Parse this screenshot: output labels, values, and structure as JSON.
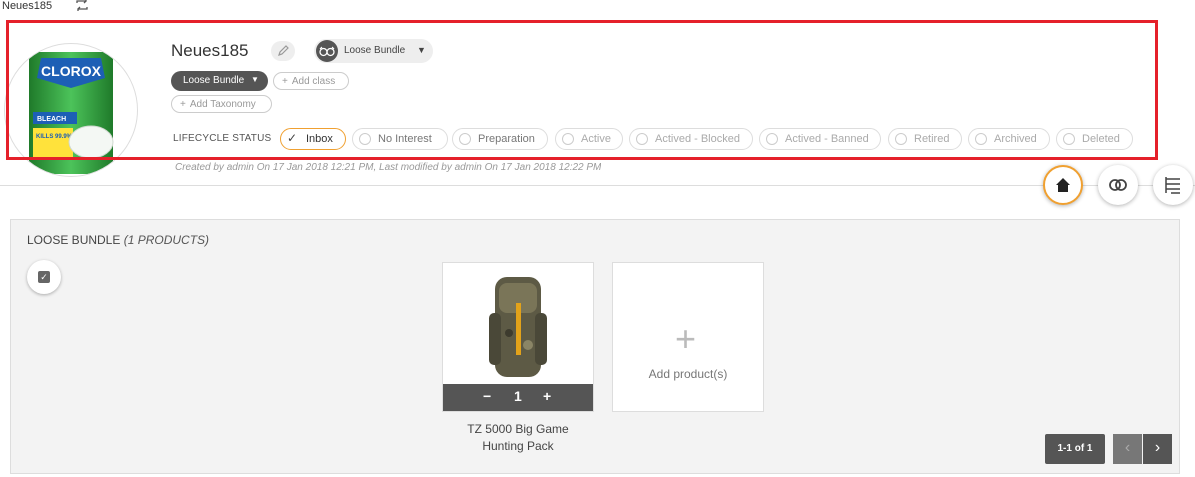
{
  "window": {
    "title": "Neues185",
    "refresh_icon": "refresh-icon"
  },
  "header": {
    "product_name": "Neues185",
    "bundle_type": "Loose Bundle",
    "class_label": "Loose Bundle",
    "add_class": "Add class",
    "add_taxonomy": "Add Taxonomy",
    "lifecycle_label": "LIFECYCLE STATUS",
    "lifecycle": [
      {
        "label": "Inbox",
        "selected": true
      },
      {
        "label": "No Interest",
        "selected": false
      },
      {
        "label": "Preparation",
        "selected": false
      },
      {
        "label": "Active",
        "selected": false
      },
      {
        "label": "Actived - Blocked",
        "selected": false
      },
      {
        "label": "Actived - Banned",
        "selected": false
      },
      {
        "label": "Retired",
        "selected": false
      },
      {
        "label": "Archived",
        "selected": false
      },
      {
        "label": "Deleted",
        "selected": false
      }
    ],
    "created_text": "Created by admin On 17 Jan 2018 12:21 PM, Last modified by admin On 17 Jan 2018 12:22 PM",
    "avatar_brand": "CLOROX",
    "avatar_sub": "BLEACH",
    "avatar_badge": "KILLS 99.9%"
  },
  "actions": {
    "home_icon": "home-icon",
    "link_icon": "link-icon",
    "tree_icon": "tree-icon"
  },
  "panel": {
    "title": "LOOSE BUNDLE",
    "count": "(1 PRODUCTS)",
    "products": [
      {
        "name_line1": "TZ 5000 Big Game",
        "name_line2": "Hunting Pack",
        "quantity": "1",
        "minus": "−",
        "plus": "+"
      }
    ],
    "add_label": "Add product(s)",
    "add_symbol": "+",
    "pager": "1-1 of 1",
    "prev": "‹",
    "next": "›"
  },
  "colors": {
    "highlight": "#e5202a",
    "accent": "#f0a030",
    "dark": "#555555"
  }
}
